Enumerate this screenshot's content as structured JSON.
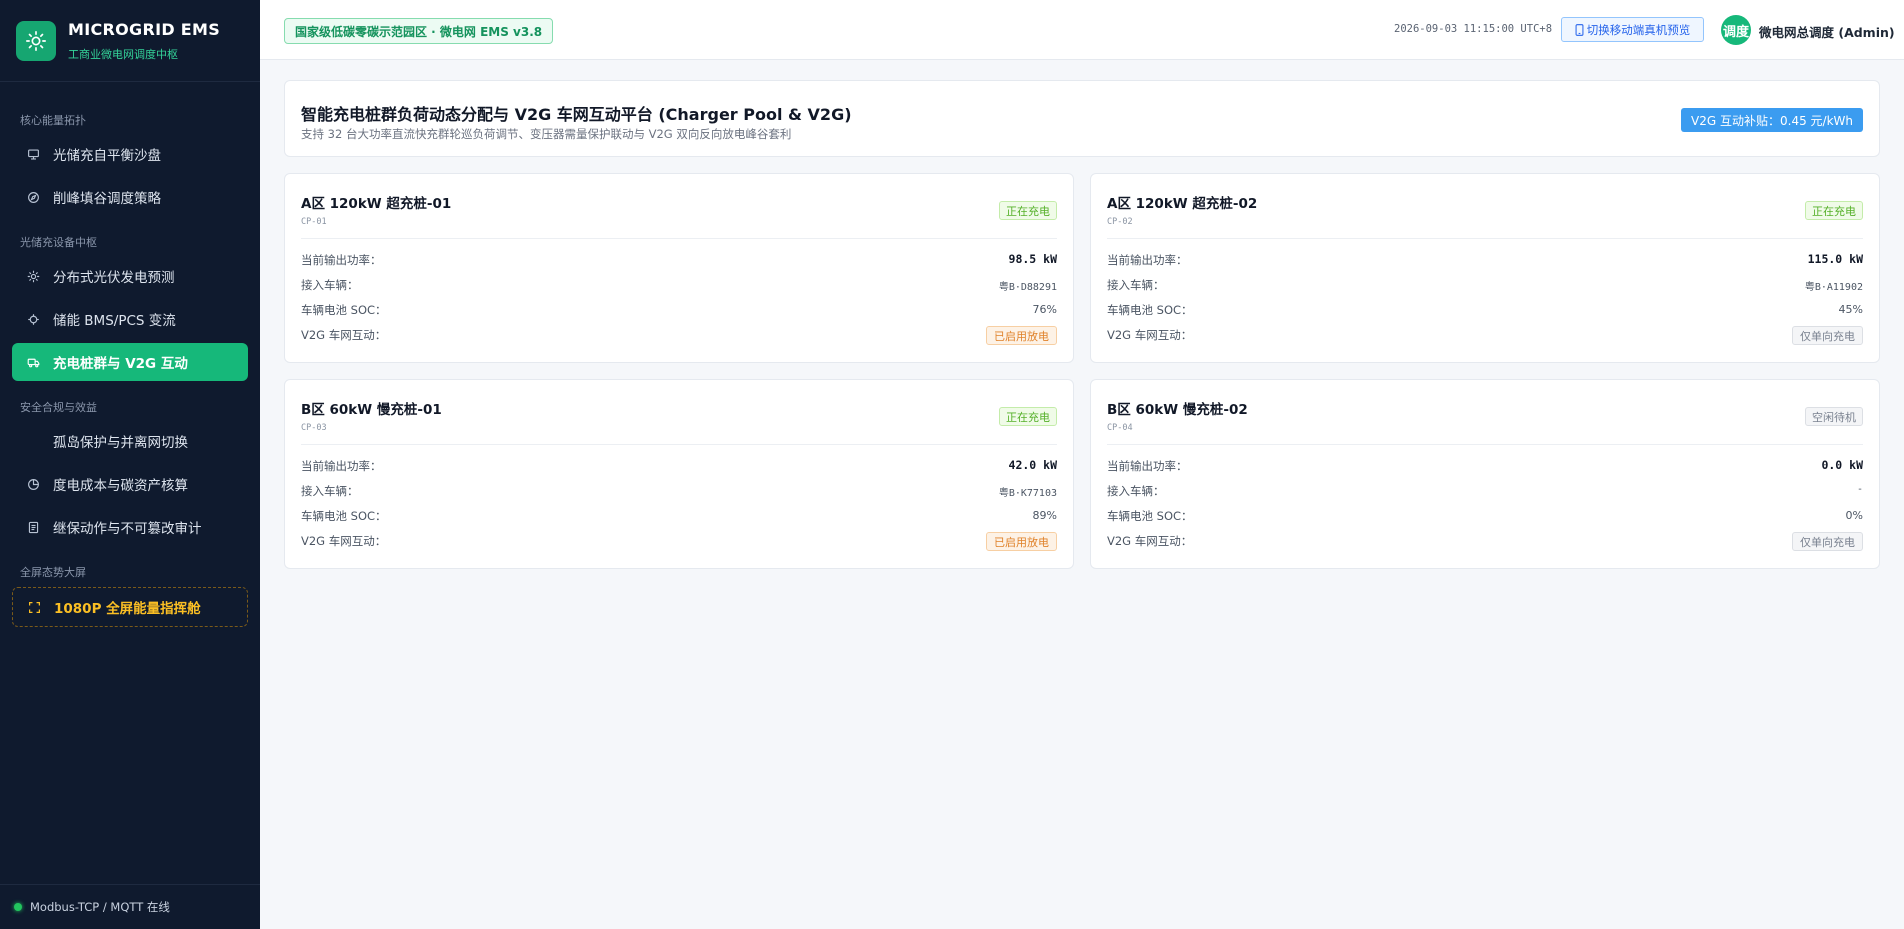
{
  "brand": {
    "title": "MICROGRID EMS",
    "subtitle": "工商业微电网调度中枢"
  },
  "sidebar": {
    "groups": [
      {
        "label": "核心能量拓扑"
      },
      {
        "label": "光储充设备中枢"
      },
      {
        "label": "安全合规与效益"
      },
      {
        "label": "全屏态势大屏"
      }
    ],
    "items": [
      {
        "label": "光储充自平衡沙盘",
        "icon": "monitor-icon"
      },
      {
        "label": "削峰填谷调度策略",
        "icon": "compass-icon"
      },
      {
        "label": "分布式光伏发电预测",
        "icon": "sun-icon"
      },
      {
        "label": "储能 BMS/PCS 变流",
        "icon": "chip-icon"
      },
      {
        "label": "充电桩群与 V2G 互动",
        "icon": "vehicle-icon",
        "active": true
      },
      {
        "label": "孤岛保护与并离网切换",
        "icon": ""
      },
      {
        "label": "度电成本与碳资产核算",
        "icon": "pie-icon"
      },
      {
        "label": "继保动作与不可篡改审计",
        "icon": "document-icon"
      },
      {
        "label": "1080P 全屏能量指挥舱",
        "icon": "fullscreen-icon"
      }
    ],
    "footer": "Modbus-TCP / MQTT 在线"
  },
  "header": {
    "site_badge": "国家级低碳零碳示范园区 · 微电网 EMS v3.8",
    "time": "2026-09-03 11:15:00 UTC+8",
    "mobile_preview": "切换移动端真机预览",
    "avatar": "调度",
    "user": "微电网总调度 (Admin)"
  },
  "page": {
    "title": "智能充电桩群负荷动态分配与 V2G 车网互动平台 (Charger Pool & V2G)",
    "subtitle": "支持 32 台大功率直流快充群轮巡负荷调节、变压器需量保护联动与 V2G 双向反向放电峰谷套利",
    "subsidy": "V2G 互动补贴：0.45 元/kWh"
  },
  "labels": {
    "power": "当前输出功率：",
    "vehicle": "接入车辆：",
    "soc": "车辆电池 SOC：",
    "v2g": "V2G 车网互动："
  },
  "chargers": [
    {
      "name": "A区 120kW 超充桩-01",
      "id": "CP-01",
      "status": "正在充电",
      "power": "98.5 kW",
      "vehicle": "粤B·D88291",
      "soc": "76%",
      "v2g": "已启用放电"
    },
    {
      "name": "A区 120kW 超充桩-02",
      "id": "CP-02",
      "status": "正在充电",
      "power": "115.0 kW",
      "vehicle": "粤B·A11902",
      "soc": "45%",
      "v2g": "仅单向充电"
    },
    {
      "name": "B区 60kW 慢充桩-01",
      "id": "CP-03",
      "status": "正在充电",
      "power": "42.0 kW",
      "vehicle": "粤B·K77103",
      "soc": "89%",
      "v2g": "已启用放电"
    },
    {
      "name": "B区 60kW 慢充桩-02",
      "id": "CP-04",
      "status": "空闲待机",
      "power": "0.0 kW",
      "vehicle": "-",
      "soc": "0%",
      "v2g": "仅单向充电"
    }
  ],
  "colors": {
    "sidebar_bg": "#0f1a2e",
    "accent_green": "#16b87a",
    "status_green": "#55b029",
    "status_orange": "#e0822a",
    "status_gray": "#7a8290",
    "subsidy_blue": "#3b9cf0",
    "warning_gold": "#fbbf24"
  }
}
